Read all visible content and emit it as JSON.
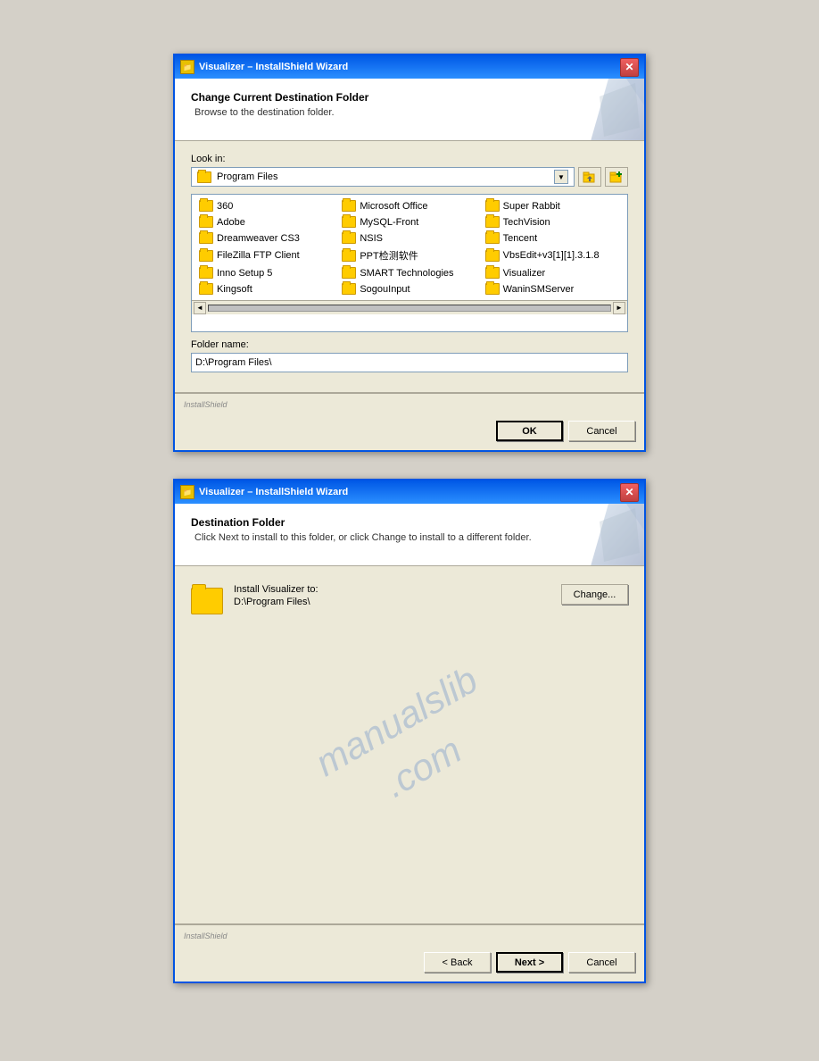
{
  "dialog1": {
    "title": "Visualizer – InstallShield Wizard",
    "header": {
      "title": "Change Current Destination Folder",
      "subtitle": "Browse to the destination folder."
    },
    "look_in_label": "Look in:",
    "look_in_value": "Program Files",
    "folders": [
      "360",
      "Adobe",
      "Dreamweaver CS3",
      "FileZilla FTP Client",
      "Inno Setup 5",
      "Kingsoft",
      "Microsoft Office",
      "MySQL-Front",
      "NSIS",
      "PPT检测软件",
      "SMART Technologies",
      "SogouInput",
      "Super Rabbit",
      "TechVision",
      "Tencent",
      "VbsEdit+v3[1][1].3.1.8",
      "Visualizer",
      "WaninSMServer"
    ],
    "folder_name_label": "Folder name:",
    "folder_name_value": "D:\\Program Files\\",
    "installshield_label": "InstallShield",
    "ok_label": "OK",
    "cancel_label": "Cancel"
  },
  "dialog2": {
    "title": "Visualizer – InstallShield Wizard",
    "header": {
      "title": "Destination Folder",
      "subtitle": "Click Next to install to this folder, or click Change to install to a different folder."
    },
    "install_label": "Install Visualizer to:",
    "install_path": "D:\\Program Files\\",
    "change_label": "Change...",
    "installshield_label": "InstallShield",
    "back_label": "< Back",
    "next_label": "Next >",
    "cancel_label": "Cancel",
    "watermark_line1": "manualslib",
    "watermark_line2": ".com"
  }
}
